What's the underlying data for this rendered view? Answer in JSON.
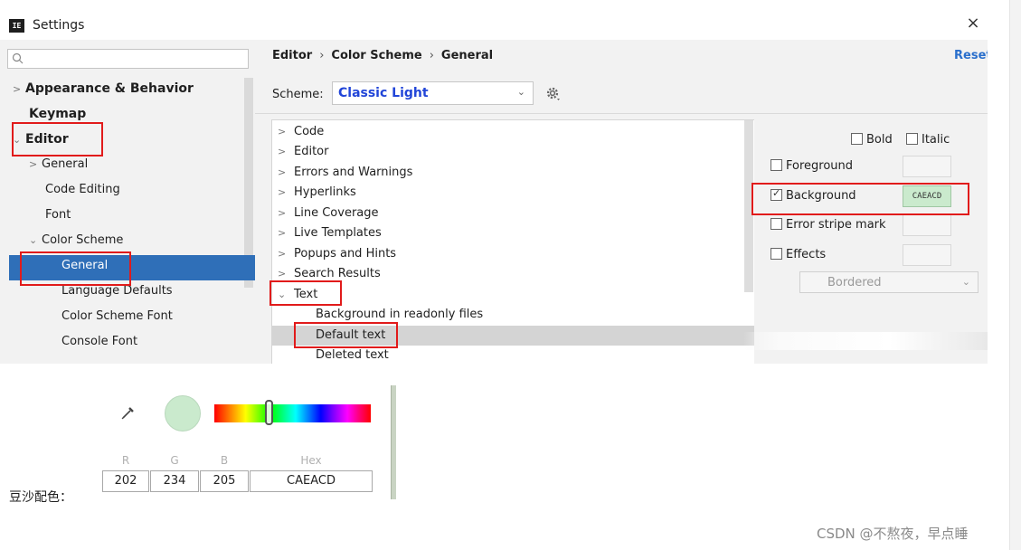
{
  "window": {
    "app_icon_text": "IE",
    "title": "Settings",
    "close_glyph": "×"
  },
  "left_tree": {
    "search_placeholder": "",
    "items": [
      {
        "label": "Appearance & Behavior",
        "chevron": ">"
      },
      {
        "label": "Keymap",
        "chevron": ""
      },
      {
        "label": "Editor",
        "chevron": "⌄"
      },
      {
        "label": "General",
        "chevron": ">"
      },
      {
        "label": "Code Editing",
        "chevron": ""
      },
      {
        "label": "Font",
        "chevron": ""
      },
      {
        "label": "Color Scheme",
        "chevron": "⌄"
      },
      {
        "label": "General",
        "chevron": ""
      },
      {
        "label": "Language Defaults",
        "chevron": ""
      },
      {
        "label": "Color Scheme Font",
        "chevron": ""
      },
      {
        "label": "Console Font",
        "chevron": ""
      }
    ]
  },
  "breadcrumb": {
    "items": [
      "Editor",
      "Color Scheme",
      "General"
    ],
    "separator": "›"
  },
  "reset_label": "Reset",
  "scheme": {
    "label": "Scheme:",
    "value": "Classic Light",
    "arrow": "⌄"
  },
  "element_tree": {
    "items": [
      {
        "label": "Code",
        "chevron": ">"
      },
      {
        "label": "Editor",
        "chevron": ">"
      },
      {
        "label": "Errors and Warnings",
        "chevron": ">"
      },
      {
        "label": "Hyperlinks",
        "chevron": ">"
      },
      {
        "label": "Line Coverage",
        "chevron": ">"
      },
      {
        "label": "Live Templates",
        "chevron": ">"
      },
      {
        "label": "Popups and Hints",
        "chevron": ">"
      },
      {
        "label": "Search Results",
        "chevron": ">"
      },
      {
        "label": "Text",
        "chevron": "⌄"
      },
      {
        "label": "Background in readonly files",
        "chevron": ""
      },
      {
        "label": "Default text",
        "chevron": ""
      },
      {
        "label": "Deleted text",
        "chevron": ""
      }
    ]
  },
  "attributes": {
    "bold_label": "Bold",
    "italic_label": "Italic",
    "foreground_label": "Foreground",
    "background_label": "Background",
    "background_value": "CAEACD",
    "background_checked": true,
    "error_stripe_label": "Error stripe mark",
    "effects_label": "Effects",
    "effects_type": "Bordered",
    "effects_arrow": "⌄"
  },
  "colors": {
    "background_color": "#CAEACD",
    "accent": "#2f6fb8",
    "scheme_value_color": "#2145d8",
    "annotation_red": "#e11b1b"
  },
  "color_picker": {
    "r_label": "R",
    "g_label": "G",
    "b_label": "B",
    "hex_label": "Hex",
    "r": "202",
    "g": "234",
    "b": "205",
    "hex": "CAEACD",
    "hue_position": 0.35
  },
  "caption": "豆沙配色：",
  "watermark": "CSDN @不熬夜，早点睡"
}
